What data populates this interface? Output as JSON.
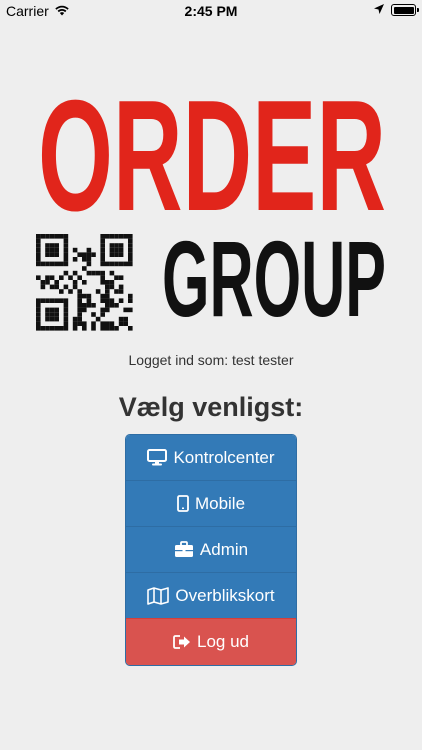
{
  "status_bar": {
    "carrier": "Carrier",
    "time": "2:45 PM"
  },
  "logo": {
    "line1": "ORDER",
    "line2": "GROUP",
    "colors": {
      "red": "#e1251b",
      "black": "#111111"
    }
  },
  "logged_in_text": "Logget ind som: test tester",
  "heading": "Vælg venligst:",
  "menu": {
    "items": [
      {
        "label": "Kontrolcenter",
        "icon": "monitor-icon"
      },
      {
        "label": "Mobile",
        "icon": "mobile-icon"
      },
      {
        "label": "Admin",
        "icon": "briefcase-icon"
      },
      {
        "label": "Overblikskort",
        "icon": "map-icon"
      }
    ],
    "logout": {
      "label": "Log ud",
      "icon": "logout-icon"
    }
  },
  "colors": {
    "primary": "#337ab7",
    "danger": "#d9534f",
    "background": "#eeeeee"
  }
}
